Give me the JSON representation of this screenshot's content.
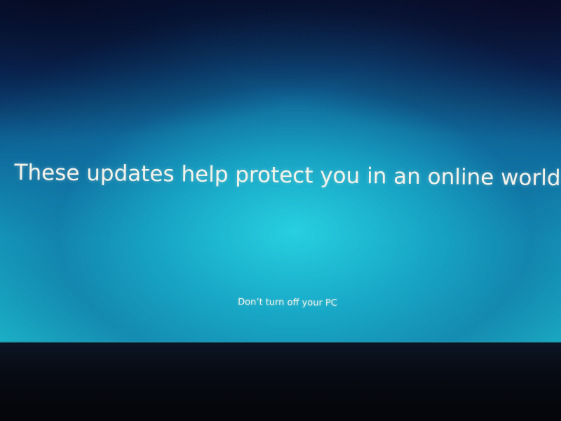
{
  "update_screen": {
    "headline": "These updates help protect you in an online world",
    "footer_message": "Don’t turn off your PC"
  },
  "colors": {
    "screen_accent": "#1cb7c9",
    "text": "#f4f2ea"
  }
}
